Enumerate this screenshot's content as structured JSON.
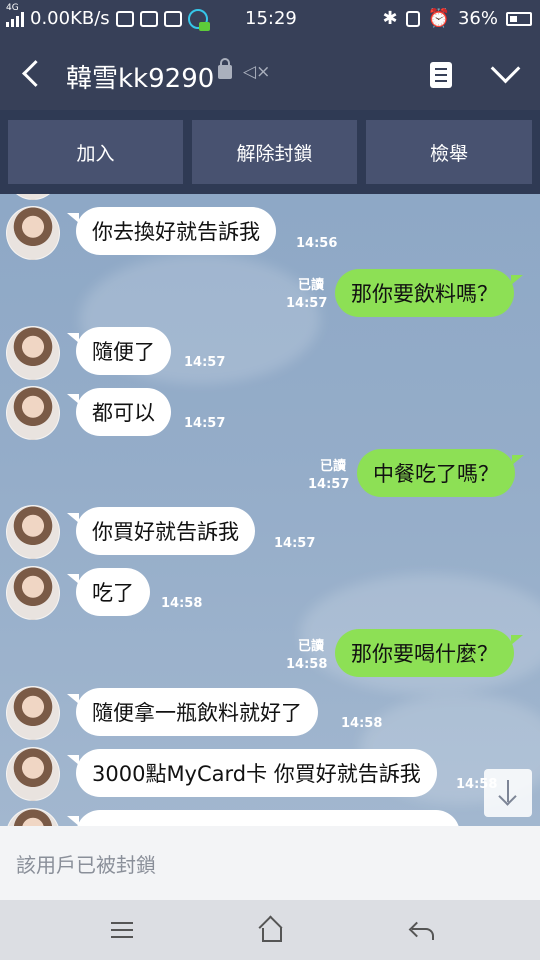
{
  "status_bar": {
    "network_type": "4G",
    "speed": "0.00KB/s",
    "time": "15:29",
    "battery": "36%"
  },
  "header": {
    "title": "韓雪kk9290",
    "icons": [
      "back-icon",
      "lock-icon",
      "mute-icon",
      "notes-icon",
      "chevron-down-icon"
    ]
  },
  "actions": {
    "join": "加入",
    "unblock": "解除封鎖",
    "report": "檢舉"
  },
  "messages": [
    {
      "dir": "in",
      "text": "你去換好就告訴我",
      "time": "14:56"
    },
    {
      "dir": "out",
      "text": "那你要飲料嗎？",
      "time": "14:57",
      "read": "已讀"
    },
    {
      "dir": "in",
      "text": "隨便了",
      "time": "14:57"
    },
    {
      "dir": "in",
      "text": "都可以",
      "time": "14:57"
    },
    {
      "dir": "out",
      "text": "中餐吃了嗎？",
      "time": "14:57",
      "read": "已讀"
    },
    {
      "dir": "in",
      "text": "你買好就告訴我",
      "time": "14:57"
    },
    {
      "dir": "in",
      "text": "吃了",
      "time": "14:58"
    },
    {
      "dir": "out",
      "text": "那你要喝什麼？",
      "time": "14:58",
      "read": "已讀"
    },
    {
      "dir": "in",
      "text": "隨便拿一瓶飲料就好了",
      "time": "14:58"
    },
    {
      "dir": "in",
      "text": "3000點MyCard卡  你買好就告訴我",
      "time": "14:58"
    }
  ],
  "footer": {
    "blocked_text": "該用戶已被封鎖"
  },
  "colors": {
    "header_bg": "#374058",
    "outgoing_bubble": "#8de055",
    "incoming_bubble": "#ffffff",
    "chat_bg": "#95adc9"
  }
}
